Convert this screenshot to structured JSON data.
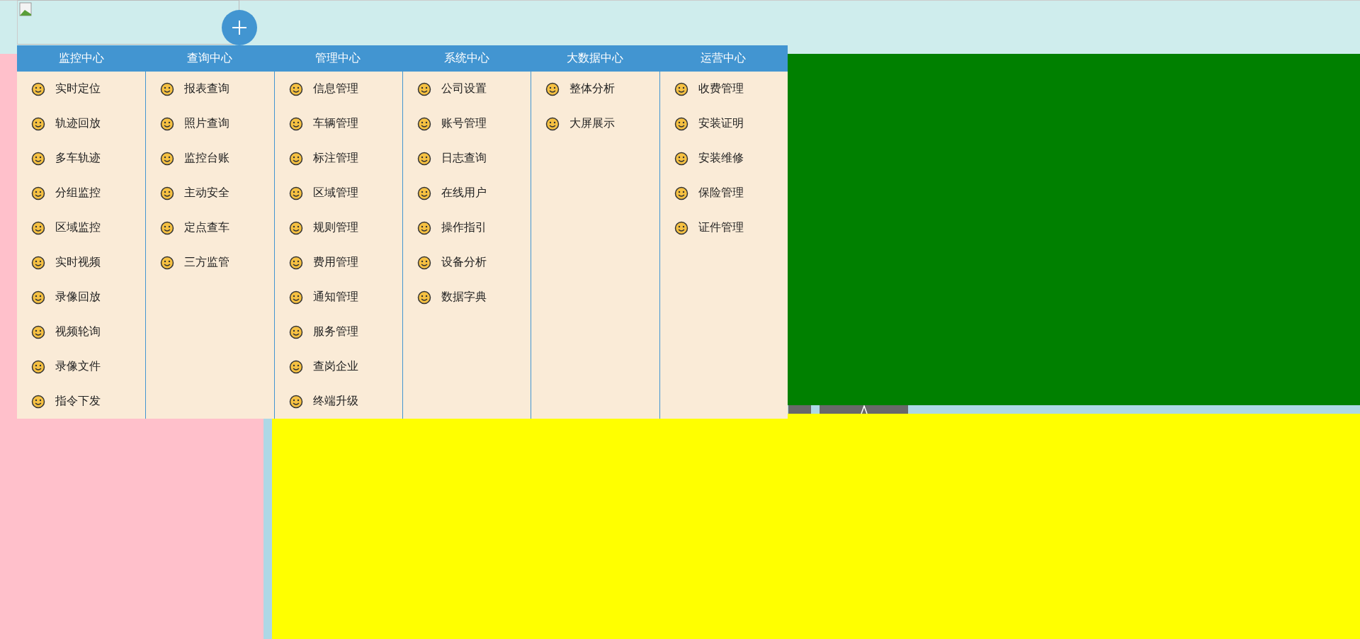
{
  "menu": {
    "columns": [
      {
        "title": "监控中心",
        "items": [
          "实时定位",
          "轨迹回放",
          "多车轨迹",
          "分组监控",
          "区域监控",
          "实时视频",
          "录像回放",
          "视频轮询",
          "录像文件",
          "指令下发"
        ]
      },
      {
        "title": "查询中心",
        "items": [
          "报表查询",
          "照片查询",
          "监控台账",
          "主动安全",
          "定点查车",
          "三方监管"
        ]
      },
      {
        "title": "管理中心",
        "items": [
          "信息管理",
          "车辆管理",
          "标注管理",
          "区域管理",
          "规则管理",
          "费用管理",
          "通知管理",
          "服务管理",
          "查岗企业",
          "终端升级"
        ]
      },
      {
        "title": "系统中心",
        "items": [
          "公司设置",
          "账号管理",
          "日志查询",
          "在线用户",
          "操作指引",
          "设备分析",
          "数据字典"
        ]
      },
      {
        "title": "大数据中心",
        "items": [
          "整体分析",
          "大屏展示"
        ]
      },
      {
        "title": "运营中心",
        "items": [
          "收费管理",
          "安装证明",
          "安装维修",
          "保险管理",
          "证件管理"
        ]
      }
    ]
  }
}
